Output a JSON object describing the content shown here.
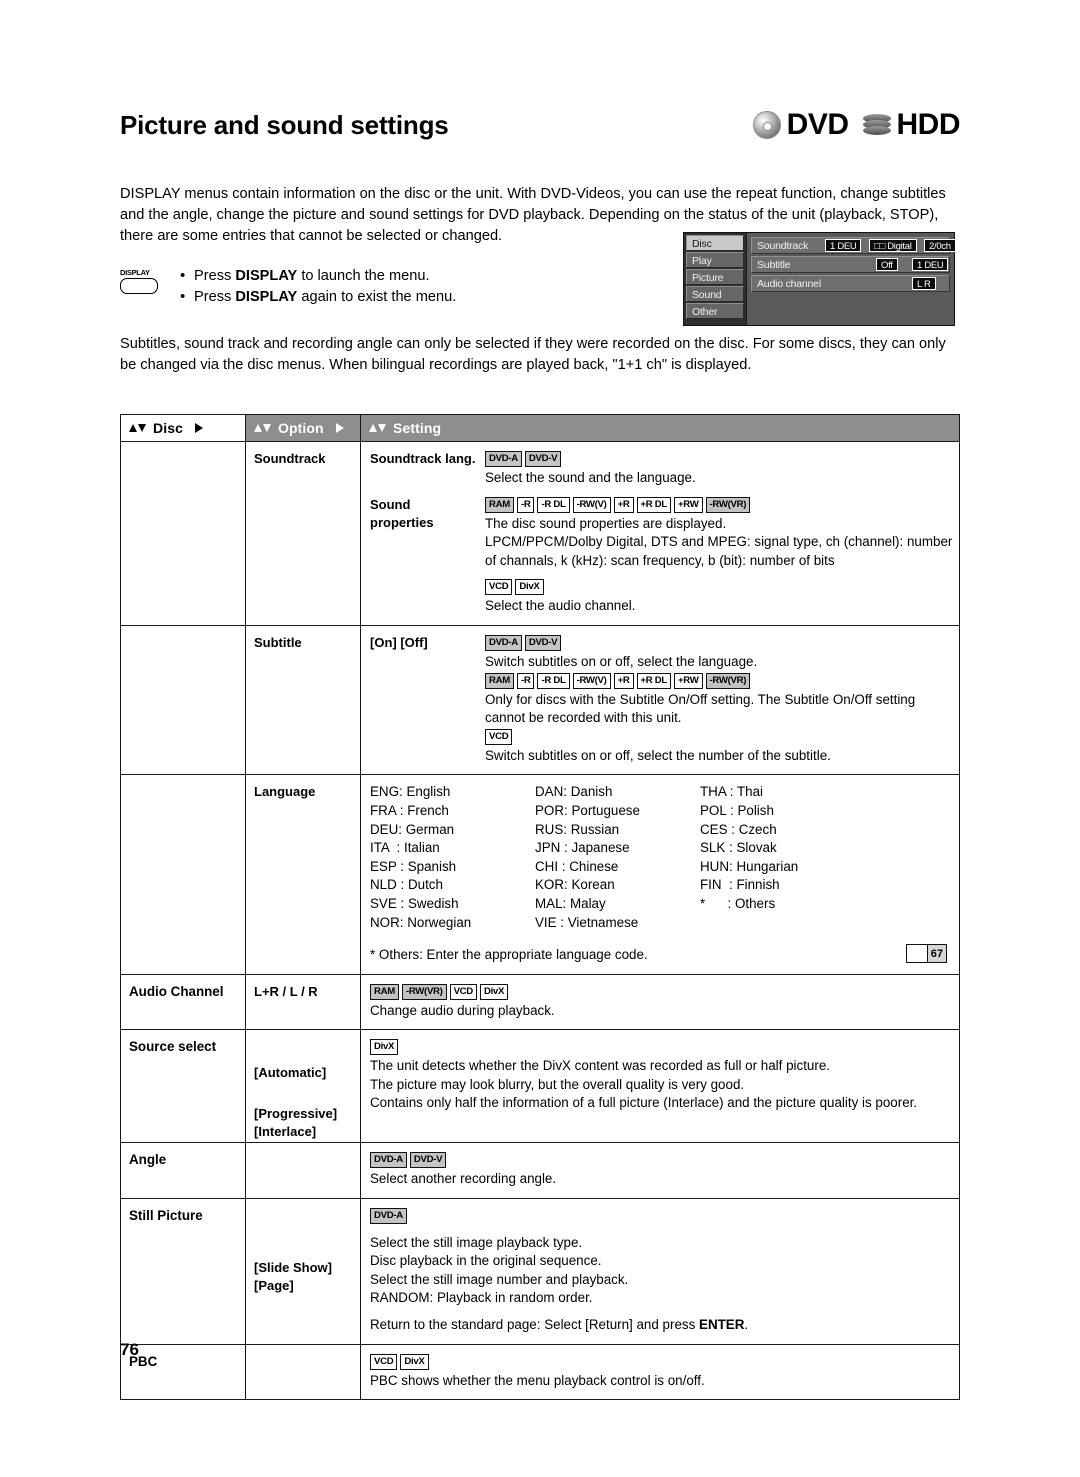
{
  "header": {
    "title": "Picture and sound settings",
    "media_badges": [
      {
        "icon": "disc-icon",
        "label": "DVD"
      },
      {
        "icon": "hdd-icon",
        "label": "HDD"
      }
    ]
  },
  "intro_paragraph": "DISPLAY menus contain information on the disc or the unit. With DVD-Videos, you can use the repeat function, change subtitles and the angle, change the picture and sound settings for DVD playback. Depending on the status of the unit (playback, STOP), there are some entries that cannot be selected or changed.",
  "display_block": {
    "key_label": "DISPLAY",
    "bullets": [
      {
        "pre": "Press ",
        "bold": "DISPLAY",
        "post": " to launch the menu."
      },
      {
        "pre": "Press ",
        "bold": "DISPLAY",
        "post": " again to exist the menu."
      }
    ]
  },
  "subtitle_paragraph": "Subtitles, sound track and recording angle can only be selected if they were recorded on the disc. For some discs, they can only be changed via the disc menus. When bilingual recordings are played back, \"1+1 ch\" is displayed.",
  "osd": {
    "menu_items": [
      "Disc",
      "Play",
      "Picture",
      "Sound",
      "Other"
    ],
    "active_item": "Disc",
    "rows": [
      {
        "label": "Soundtrack",
        "chips": [
          "1 DEU",
          "□□ Digital",
          "2/0ch"
        ]
      },
      {
        "label": "Subtitle",
        "chips": [
          "Off",
          "1 DEU"
        ]
      },
      {
        "label": "Audio channel",
        "chips": [
          "L R"
        ]
      }
    ]
  },
  "table": {
    "headers": [
      {
        "label": "Disc",
        "arrows": "up-down",
        "caret": true
      },
      {
        "label": "Option",
        "arrows": "up-down",
        "caret": true
      },
      {
        "label": "Setting",
        "arrows": "up-down",
        "caret": false
      }
    ],
    "rows": [
      {
        "disc": "",
        "option": "Soundtrack",
        "blocks": [
          {
            "label": "Soundtrack lang.",
            "tags": [
              {
                "text": "DVD-A",
                "style": "gray"
              },
              {
                "text": "DVD-V",
                "style": "gray"
              }
            ],
            "lines": [
              "Select the sound and the language."
            ]
          },
          {
            "label": "Sound properties",
            "tags": [
              {
                "text": "RAM",
                "style": "gray"
              },
              {
                "text": "-R",
                "style": "white"
              },
              {
                "text": "-R DL",
                "style": "white"
              },
              {
                "text": "-RW(V)",
                "style": "white"
              },
              {
                "text": "+R",
                "style": "white"
              },
              {
                "text": "+R DL",
                "style": "white"
              },
              {
                "text": "+RW",
                "style": "white"
              },
              {
                "text": "-RW(VR)",
                "style": "gray"
              }
            ],
            "lines": [
              "The disc sound properties are displayed.",
              "LPCM/PPCM/Dolby Digital, DTS and MPEG: signal type, ch (channel): number of channals, k (kHz): scan frequency, b (bit): number of bits"
            ],
            "tags2": [
              {
                "text": "VCD",
                "style": "white"
              },
              {
                "text": "DivX",
                "style": "white"
              }
            ],
            "lines2": [
              "Select the audio channel."
            ]
          }
        ]
      },
      {
        "disc": "",
        "option": "Subtitle",
        "blocks": [
          {
            "label": "[On] [Off]",
            "tags": [
              {
                "text": "DVD-A",
                "style": "gray"
              },
              {
                "text": "DVD-V",
                "style": "gray"
              }
            ],
            "lines": [
              "Switch subtitles on or off, select the language."
            ],
            "tags2": [
              {
                "text": "RAM",
                "style": "gray"
              },
              {
                "text": "-R",
                "style": "white"
              },
              {
                "text": "-R DL",
                "style": "white"
              },
              {
                "text": "-RW(V)",
                "style": "white"
              },
              {
                "text": "+R",
                "style": "white"
              },
              {
                "text": "+R DL",
                "style": "white"
              },
              {
                "text": "+RW",
                "style": "white"
              },
              {
                "text": "-RW(VR)",
                "style": "gray"
              }
            ],
            "lines2": [
              "Only for discs with the Subtitle On/Off setting. The Subtitle On/Off setting cannot be recorded with this unit."
            ],
            "tags3": [
              {
                "text": "VCD",
                "style": "white"
              }
            ],
            "lines3": [
              "Switch subtitles on or off, select the number of the subtitle."
            ]
          }
        ]
      },
      {
        "disc": "",
        "option": "Language",
        "language_columns": [
          [
            "ENG: English",
            "FRA : French",
            "DEU: German",
            "ITA  : Italian",
            "ESP : Spanish",
            "NLD : Dutch",
            "SVE : Swedish",
            "NOR: Norwegian"
          ],
          [
            "DAN: Danish",
            "POR: Portuguese",
            "RUS: Russian",
            "JPN : Japanese",
            "CHI : Chinese",
            "KOR: Korean",
            "MAL: Malay",
            "VIE : Vietnamese"
          ],
          [
            "THA : Thai",
            "POL : Polish",
            "CES : Czech",
            "SLK : Slovak",
            "HUN: Hungarian",
            "FIN  : Finnish",
            "*      : Others"
          ]
        ],
        "language_note": "* Others: Enter the appropriate language code.",
        "page_ref": "67"
      },
      {
        "disc": "Audio Channel",
        "option": "L+R / L / R",
        "blocks": [
          {
            "tags": [
              {
                "text": "RAM",
                "style": "gray"
              },
              {
                "text": "-RW(VR)",
                "style": "gray"
              },
              {
                "text": "VCD",
                "style": "white"
              },
              {
                "text": "DivX",
                "style": "white"
              }
            ],
            "lines": [
              "Change audio during playback."
            ]
          }
        ]
      },
      {
        "disc": "Source select",
        "option": "",
        "source_select": {
          "tags": [
            {
              "text": "DivX",
              "style": "white"
            }
          ],
          "items": [
            {
              "label": "[Automatic]",
              "text": "The unit detects whether the DivX content was recorded as full or half picture."
            },
            {
              "label": "[Progressive]",
              "text": "The picture may look blurry, but the overall quality is very good."
            },
            {
              "label": "[Interlace]",
              "text": "Contains only half the information of a full picture (Interlace) and the picture quality is poorer."
            }
          ]
        }
      },
      {
        "disc": "Angle",
        "option": "",
        "blocks": [
          {
            "tags": [
              {
                "text": "DVD-A",
                "style": "gray"
              },
              {
                "text": "DVD-V",
                "style": "gray"
              }
            ],
            "lines": [
              "Select another recording angle."
            ]
          }
        ]
      },
      {
        "disc": "Still Picture",
        "option": "",
        "still_picture": {
          "tags": [
            {
              "text": "DVD-A",
              "style": "gray"
            }
          ],
          "intro": "Select the still image playback type.",
          "items": [
            {
              "label": "[Slide Show]",
              "text": "Disc playback in the original sequence."
            },
            {
              "label": "[Page]",
              "text": "Select the still image number and playback.\nRANDOM: Playback in random order."
            }
          ],
          "footer_pre": "Return to the standard page: Select [Return] and press ",
          "footer_bold": "ENTER",
          "footer_post": "."
        }
      },
      {
        "disc": "PBC",
        "option": "",
        "blocks": [
          {
            "tags": [
              {
                "text": "VCD",
                "style": "white"
              },
              {
                "text": "DivX",
                "style": "white"
              }
            ],
            "lines": [
              "PBC shows whether the menu playback control is on/off."
            ]
          }
        ]
      }
    ]
  },
  "page_number": "76"
}
